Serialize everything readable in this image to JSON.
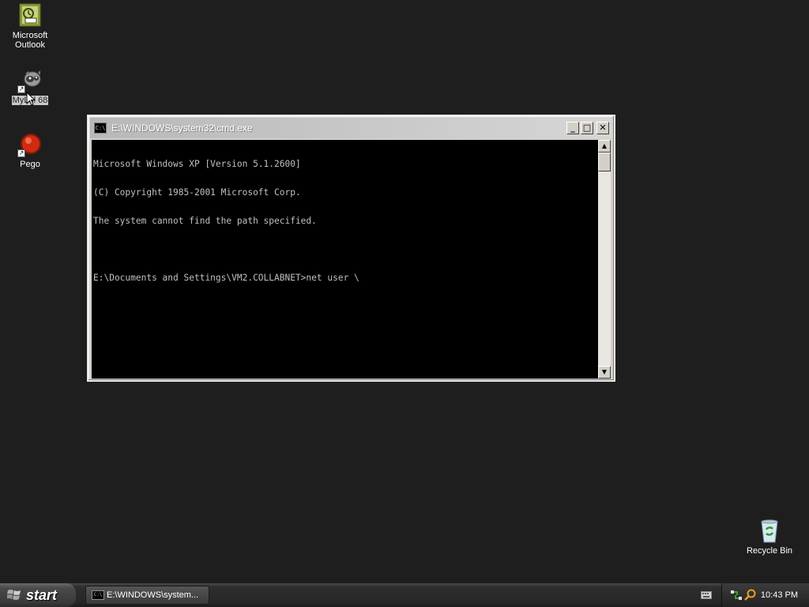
{
  "desktop": {
    "icons": [
      {
        "label": "Microsoft\nOutlook",
        "line1": "Microsoft",
        "line2": "Outlook",
        "icon": "outlook-icon"
      },
      {
        "label": "MyLol 68",
        "icon": "mylol-icon",
        "selected": true
      },
      {
        "label": "Pego",
        "icon": "pego-icon"
      },
      {
        "label": "Recycle Bin",
        "icon": "recycle-bin-icon"
      }
    ]
  },
  "cmd_window": {
    "title": "E:\\WINDOWS\\system32\\cmd.exe",
    "icon": "cmd-icon",
    "console_lines": [
      "Microsoft Windows XP [Version 5.1.2600]",
      "(C) Copyright 1985-2001 Microsoft Corp.",
      "The system cannot find the path specified.",
      "",
      "E:\\Documents and Settings\\VM2.COLLABNET>net user \\"
    ],
    "colors": {
      "background": "#000000",
      "text": "#c0c0c0"
    }
  },
  "taskbar": {
    "start_label": "start",
    "tasks": [
      {
        "label": "E:\\WINDOWS\\system...",
        "icon": "cmd-icon"
      }
    ],
    "tray_icons": [
      "keyboard-icon",
      "network-icon",
      "search-icon"
    ],
    "clock": "10:43 PM"
  }
}
